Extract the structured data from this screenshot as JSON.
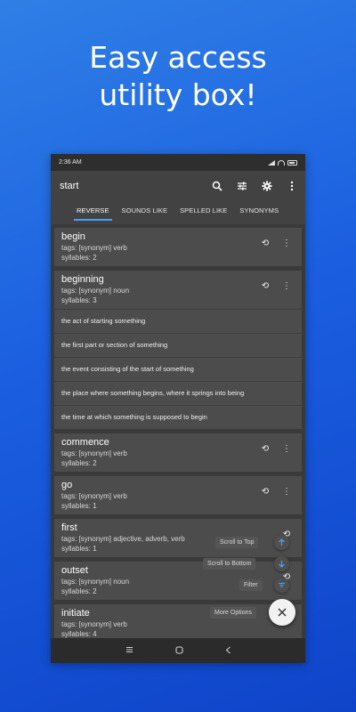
{
  "headline": {
    "line1": "Easy access",
    "line2": "utility box!"
  },
  "status": {
    "time": "2:36 AM"
  },
  "toolbar": {
    "title": "start",
    "icons": [
      "search-icon",
      "tune-icon",
      "gear-icon",
      "more-vert-icon"
    ]
  },
  "tabs": [
    {
      "label": "REVERSE",
      "active": true
    },
    {
      "label": "SOUNDS LIKE",
      "active": false
    },
    {
      "label": "SPELLED LIKE",
      "active": false
    },
    {
      "label": "SYNONYMS",
      "active": false
    }
  ],
  "words": [
    {
      "word": "begin",
      "tags": "tags: [synonym] verb",
      "syllables": "syllables: 2"
    },
    {
      "word": "beginning",
      "tags": "tags: [synonym] noun",
      "syllables": "syllables: 3",
      "definitions": [
        "the act of starting something",
        "the first part or section of something",
        "the event consisting of the start of something",
        "the place where something begins, where it springs into being",
        "the time at which something is supposed to begin"
      ]
    },
    {
      "word": "commence",
      "tags": "tags: [synonym] verb",
      "syllables": "syllables: 2"
    },
    {
      "word": "go",
      "tags": "tags: [synonym] verb",
      "syllables": "syllables: 1"
    },
    {
      "word": "first",
      "tags": "tags: [synonym] adjective, adverb, verb",
      "syllables": "syllables: 1"
    },
    {
      "word": "outset",
      "tags": "tags: [synonym] noun",
      "syllables": "syllables: 2"
    },
    {
      "word": "initiate",
      "tags": "tags: [synonym] verb",
      "syllables": "syllables: 4"
    }
  ],
  "fab": {
    "scroll_top": "Scroll to Top",
    "scroll_bottom": "Scroll to Bottom",
    "filter": "Filter",
    "more_options": "More Options"
  },
  "colors": {
    "accent": "#4a9cf5",
    "background": "#1b5fe0"
  }
}
